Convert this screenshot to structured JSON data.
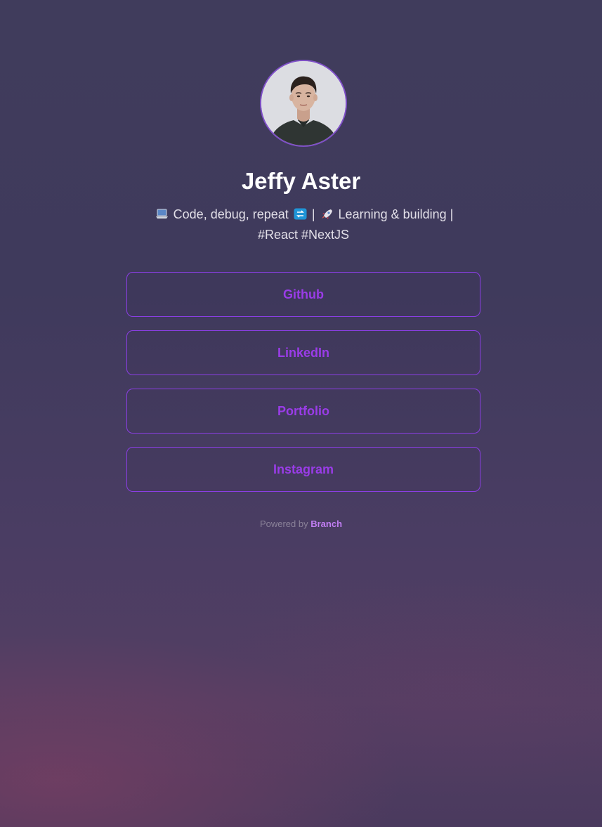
{
  "profile": {
    "name": "Jeffy Aster",
    "avatar_alt": "profile-photo",
    "bio_line1_a": "Code, debug, repeat",
    "bio_line1_sep": "|",
    "bio_line1_b": "Learning & building |",
    "bio_line2": "#React #NextJS",
    "bio_icons": [
      "laptop-icon",
      "repeat-icon",
      "rocket-icon"
    ]
  },
  "links": [
    {
      "label": "Github"
    },
    {
      "label": "LinkedIn"
    },
    {
      "label": "Portfolio"
    },
    {
      "label": "Instagram"
    }
  ],
  "footer": {
    "powered_prefix": "Powered by",
    "brand": "Branch"
  },
  "colors": {
    "accent": "#9a3ce8",
    "border": "#8b3ee4",
    "brand": "#c07ef2"
  }
}
